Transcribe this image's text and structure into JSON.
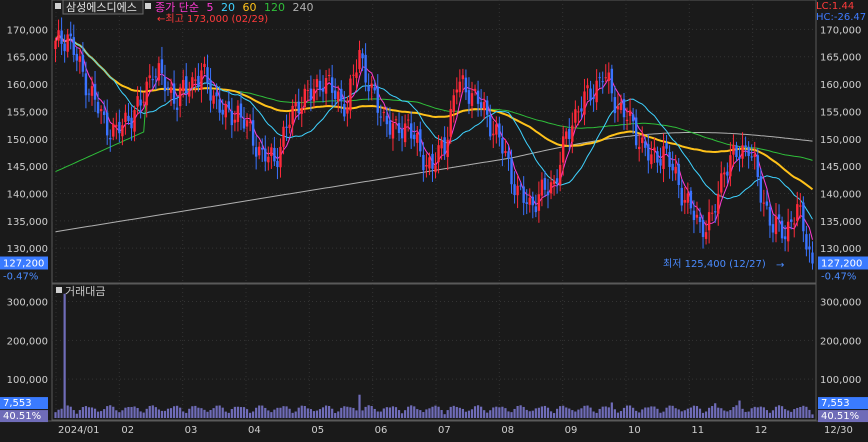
{
  "chart_data": [
    {
      "type": "candlestick",
      "title": "삼성에스디에스",
      "legend": [
        {
          "text": "종가 단순",
          "color": "#ff3bd4"
        },
        {
          "text": "5",
          "color": "#ff3bd4"
        },
        {
          "text": "20",
          "color": "#3fd2ff"
        },
        {
          "text": "60",
          "color": "#ffc21a"
        },
        {
          "text": "120",
          "color": "#2fbf3a"
        },
        {
          "text": "240",
          "color": "#b0b0b0"
        }
      ],
      "high_annotation": "←최고 173,000 (02/29)",
      "low_annotation": "최저 125,400 (12/27)",
      "lc_label": "LC:1.44",
      "hc_label": "HC:-26.47",
      "ylim": [
        124000,
        175000
      ],
      "y_ticks": [
        {
          "v": 170000,
          "label": "170,000"
        },
        {
          "v": 165000,
          "label": "165,000"
        },
        {
          "v": 160000,
          "label": "160,000"
        },
        {
          "v": 155000,
          "label": "155,000"
        },
        {
          "v": 150000,
          "label": "150,000"
        },
        {
          "v": 145000,
          "label": "145,000"
        },
        {
          "v": 140000,
          "label": "140,000"
        },
        {
          "v": 135000,
          "label": "135,000"
        },
        {
          "v": 130000,
          "label": "130,000"
        }
      ],
      "current_price": {
        "value": 127200,
        "label": "127,200",
        "change": "-0.47%"
      },
      "months": [
        "2024/01",
        "02",
        "03",
        "04",
        "05",
        "06",
        "07",
        "08",
        "09",
        "10",
        "11",
        "12"
      ],
      "end_date_label": "12/30",
      "key_closes": [
        [
          0,
          167000
        ],
        [
          4,
          169000
        ],
        [
          8,
          163000
        ],
        [
          12,
          158000
        ],
        [
          16,
          153000
        ],
        [
          20,
          151000
        ],
        [
          24,
          154000
        ],
        [
          28,
          156000
        ],
        [
          32,
          163000
        ],
        [
          36,
          160000
        ],
        [
          40,
          157000
        ],
        [
          44,
          160000
        ],
        [
          48,
          162000
        ],
        [
          52,
          158000
        ],
        [
          56,
          154000
        ],
        [
          60,
          155000
        ],
        [
          64,
          151000
        ],
        [
          68,
          147000
        ],
        [
          72,
          146000
        ],
        [
          76,
          152000
        ],
        [
          80,
          157000
        ],
        [
          84,
          158000
        ],
        [
          88,
          161000
        ],
        [
          92,
          158000
        ],
        [
          96,
          156000
        ],
        [
          100,
          166000
        ],
        [
          104,
          158000
        ],
        [
          108,
          154000
        ],
        [
          112,
          151000
        ],
        [
          116,
          153000
        ],
        [
          120,
          147000
        ],
        [
          124,
          145000
        ],
        [
          128,
          149000
        ],
        [
          132,
          160000
        ],
        [
          136,
          159000
        ],
        [
          140,
          156000
        ],
        [
          144,
          152000
        ],
        [
          148,
          147000
        ],
        [
          152,
          140000
        ],
        [
          156,
          138000
        ],
        [
          160,
          140000
        ],
        [
          164,
          142000
        ],
        [
          168,
          150000
        ],
        [
          172,
          156000
        ],
        [
          176,
          158000
        ],
        [
          180,
          162000
        ],
        [
          184,
          157000
        ],
        [
          188,
          154000
        ],
        [
          192,
          150000
        ],
        [
          196,
          146000
        ],
        [
          200,
          148000
        ],
        [
          204,
          143000
        ],
        [
          208,
          138000
        ],
        [
          212,
          134000
        ],
        [
          216,
          135000
        ],
        [
          220,
          145000
        ],
        [
          224,
          147000
        ],
        [
          228,
          149000
        ],
        [
          232,
          140000
        ],
        [
          236,
          134000
        ],
        [
          240,
          133000
        ],
        [
          244,
          137000
        ],
        [
          247,
          132000
        ],
        [
          249,
          127200
        ]
      ],
      "moving_averages": {
        "ma5_color": "#ff3bd4",
        "ma20_color": "#3fd2ff",
        "ma60_color": "#ffc21a",
        "ma120_color": "#2fbf3a",
        "ma240_color": "#b0b0b0"
      },
      "up_color": "#ff2a3a",
      "down_color": "#3a73ff"
    },
    {
      "type": "bar",
      "title": "거래대금",
      "ylim": [
        0,
        340000
      ],
      "y_ticks": [
        {
          "v": 300000,
          "label": "300,000"
        },
        {
          "v": 200000,
          "label": "200,000"
        },
        {
          "v": 100000,
          "label": "100,000"
        }
      ],
      "current_value": {
        "label": "7,553",
        "change": "40.51%"
      },
      "spikes": [
        [
          3,
          320000
        ],
        [
          100,
          60000
        ],
        [
          183,
          40000
        ],
        [
          217,
          38000
        ],
        [
          225,
          45000
        ]
      ],
      "bar_color": "#6f6cb8"
    }
  ]
}
